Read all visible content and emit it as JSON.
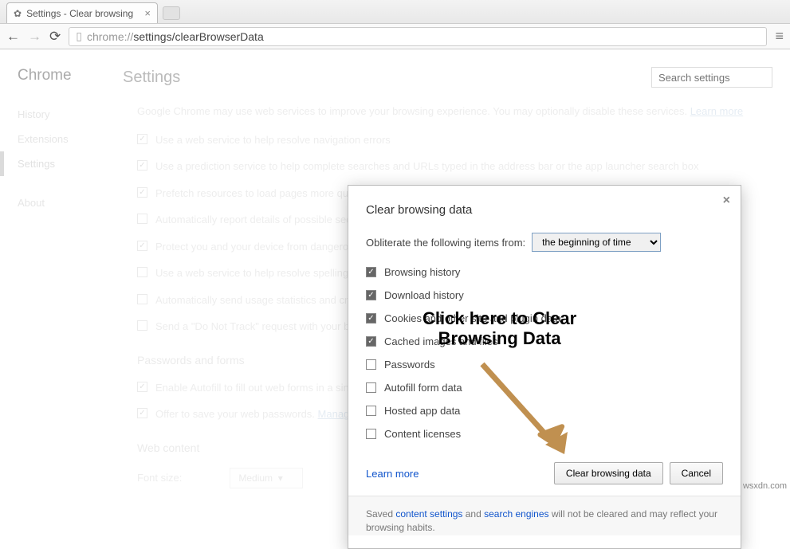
{
  "tab": {
    "title": "Settings - Clear browsing"
  },
  "url": {
    "prefix": "chrome://",
    "path": "settings/clearBrowserData"
  },
  "sidebar": {
    "title": "Chrome",
    "items": [
      "History",
      "Extensions",
      "Settings",
      "About"
    ]
  },
  "main": {
    "title": "Settings",
    "search_placeholder": "Search settings",
    "intro_text": "Google Chrome may use web services to improve your browsing experience. You may optionally disable these services. ",
    "intro_link": "Learn more",
    "privacy_checks": [
      {
        "checked": true,
        "label": "Use a web service to help resolve navigation errors"
      },
      {
        "checked": true,
        "label": "Use a prediction service to help complete searches and URLs typed in the address bar or the app launcher search box"
      },
      {
        "checked": true,
        "label": "Prefetch resources to load pages more quickly"
      },
      {
        "checked": false,
        "label": "Automatically report details of possible security incidents to Google"
      },
      {
        "checked": true,
        "label": "Protect you and your device from dangerous sites"
      },
      {
        "checked": false,
        "label": "Use a web service to help resolve spelling errors"
      },
      {
        "checked": false,
        "label": "Automatically send usage statistics and crash reports to Google"
      },
      {
        "checked": false,
        "label": "Send a \"Do Not Track\" request with your browsing traffic"
      }
    ],
    "pw_section": "Passwords and forms",
    "pw_checks": [
      {
        "checked": true,
        "label": "Enable Autofill to fill out web forms in a single click. "
      },
      {
        "checked": true,
        "label": "Offer to save your web passwords. ",
        "link": "Manage passwords"
      }
    ],
    "web_section": "Web content",
    "font_label": "Font size:",
    "font_value": "Medium"
  },
  "dialog": {
    "title": "Clear browsing data",
    "oblit_label": "Obliterate the following items from:",
    "time_range": "the beginning of time",
    "options": [
      {
        "checked": true,
        "label": "Browsing history"
      },
      {
        "checked": true,
        "label": "Download history"
      },
      {
        "checked": true,
        "label": "Cookies and other site and plugin data"
      },
      {
        "checked": true,
        "label": "Cached images and files"
      },
      {
        "checked": false,
        "label": "Passwords"
      },
      {
        "checked": false,
        "label": "Autofill form data"
      },
      {
        "checked": false,
        "label": "Hosted app data"
      },
      {
        "checked": false,
        "label": "Content licenses"
      }
    ],
    "learn_more": "Learn more",
    "primary": "Clear browsing data",
    "cancel": "Cancel",
    "footer_prefix": "Saved ",
    "footer_link1": "content settings",
    "footer_mid": " and ",
    "footer_link2": "search engines",
    "footer_suffix": " will not be cleared and may reflect your browsing habits."
  },
  "annotation": {
    "line1": "Click here to Clear",
    "line2": "Browsing Data"
  },
  "watermark": "wsxdn.com"
}
